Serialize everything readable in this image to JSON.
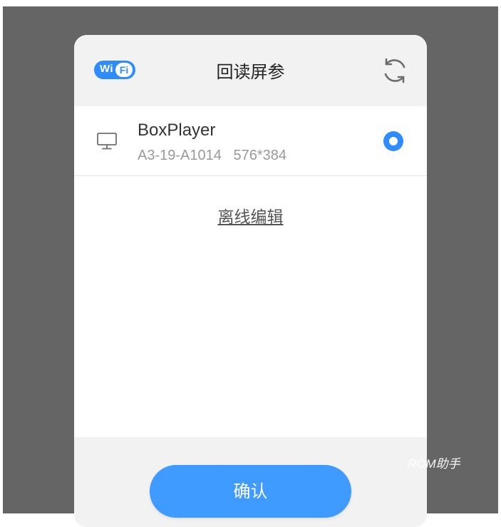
{
  "header": {
    "badge_wi": "Wi",
    "badge_fi": "Fi",
    "title": "回读屏参",
    "refresh_icon": "refresh-icon"
  },
  "device": {
    "icon": "monitor-icon",
    "name": "BoxPlayer",
    "subtitle": "A3-19-A1014   576*384",
    "selected": true
  },
  "offline_edit_label": "离线编辑",
  "confirm_label": "确认",
  "watermark": "ROM助手",
  "colors": {
    "accent": "#3f9bff",
    "overlay": "#656565",
    "header_bg": "#f2f2f2"
  }
}
